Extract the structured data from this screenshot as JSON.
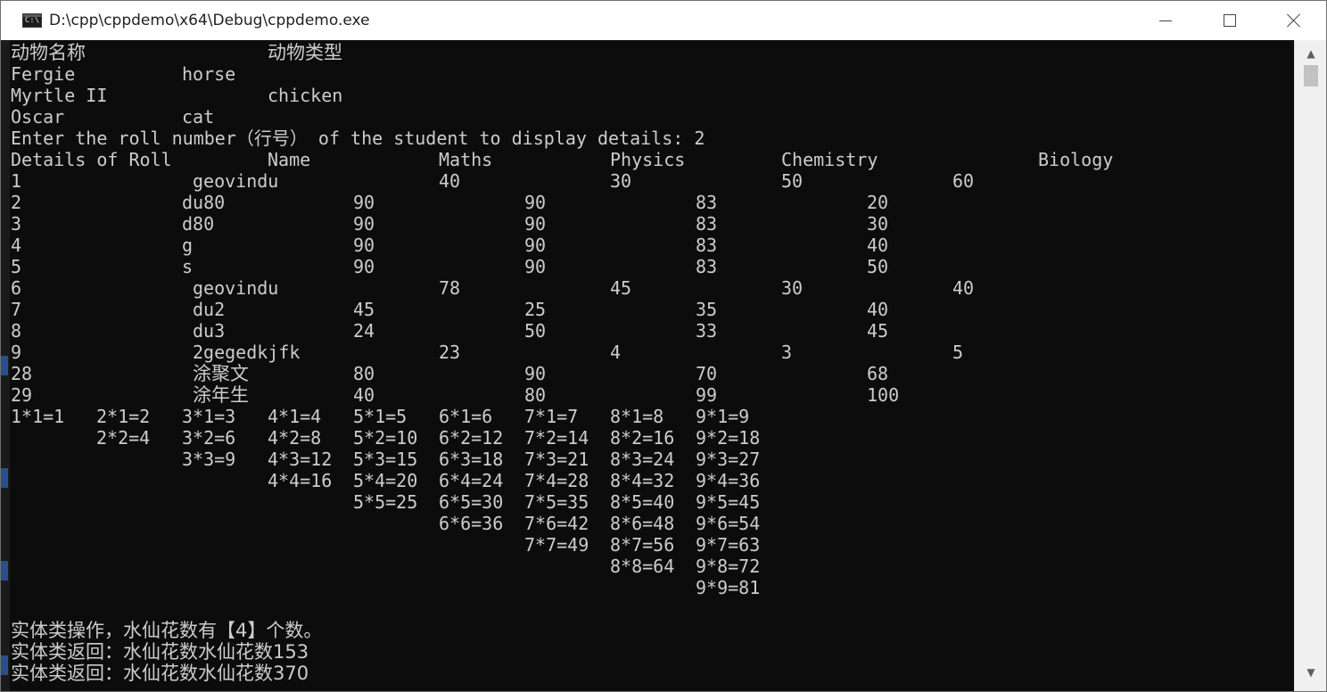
{
  "window": {
    "title": "D:\\cpp\\cppdemo\\x64\\Debug\\cppdemo.exe",
    "icon_label": "C:\\"
  },
  "console_lines": [
    [
      {
        "c": 0,
        "t": "动物名称",
        "cjk": true
      },
      {
        "c": 24,
        "t": "动物类型",
        "cjk": true
      }
    ],
    [
      {
        "c": 0,
        "t": "Fergie"
      },
      {
        "c": 16,
        "t": "horse"
      }
    ],
    [
      {
        "c": 0,
        "t": "Myrtle II"
      },
      {
        "c": 24,
        "t": "chicken"
      }
    ],
    [
      {
        "c": 0,
        "t": "Oscar"
      },
      {
        "c": 16,
        "t": "cat"
      }
    ],
    [
      {
        "c": 0,
        "t": "Enter the roll number（行号） of the student to display details: 2"
      }
    ],
    [
      {
        "c": 0,
        "t": "Details of Roll"
      },
      {
        "c": 24,
        "t": "Name"
      },
      {
        "c": 40,
        "t": "Maths"
      },
      {
        "c": 56,
        "t": "Physics"
      },
      {
        "c": 72,
        "t": "Chemistry"
      },
      {
        "c": 96,
        "t": "Biology"
      }
    ],
    [
      {
        "c": 0,
        "t": "1"
      },
      {
        "c": 17,
        "t": "geovindu"
      },
      {
        "c": 40,
        "t": "40"
      },
      {
        "c": 56,
        "t": "30"
      },
      {
        "c": 72,
        "t": "50"
      },
      {
        "c": 88,
        "t": "60"
      }
    ],
    [
      {
        "c": 0,
        "t": "2"
      },
      {
        "c": 16,
        "t": "du80"
      },
      {
        "c": 32,
        "t": "90"
      },
      {
        "c": 48,
        "t": "90"
      },
      {
        "c": 64,
        "t": "83"
      },
      {
        "c": 80,
        "t": "20"
      }
    ],
    [
      {
        "c": 0,
        "t": "3"
      },
      {
        "c": 16,
        "t": "d80"
      },
      {
        "c": 32,
        "t": "90"
      },
      {
        "c": 48,
        "t": "90"
      },
      {
        "c": 64,
        "t": "83"
      },
      {
        "c": 80,
        "t": "30"
      }
    ],
    [
      {
        "c": 0,
        "t": "4"
      },
      {
        "c": 16,
        "t": "g"
      },
      {
        "c": 32,
        "t": "90"
      },
      {
        "c": 48,
        "t": "90"
      },
      {
        "c": 64,
        "t": "83"
      },
      {
        "c": 80,
        "t": "40"
      }
    ],
    [
      {
        "c": 0,
        "t": "5"
      },
      {
        "c": 16,
        "t": "s"
      },
      {
        "c": 32,
        "t": "90"
      },
      {
        "c": 48,
        "t": "90"
      },
      {
        "c": 64,
        "t": "83"
      },
      {
        "c": 80,
        "t": "50"
      }
    ],
    [
      {
        "c": 0,
        "t": "6"
      },
      {
        "c": 17,
        "t": "geovindu"
      },
      {
        "c": 40,
        "t": "78"
      },
      {
        "c": 56,
        "t": "45"
      },
      {
        "c": 72,
        "t": "30"
      },
      {
        "c": 88,
        "t": "40"
      }
    ],
    [
      {
        "c": 0,
        "t": "7"
      },
      {
        "c": 17,
        "t": "du2"
      },
      {
        "c": 32,
        "t": "45"
      },
      {
        "c": 48,
        "t": "25"
      },
      {
        "c": 64,
        "t": "35"
      },
      {
        "c": 80,
        "t": "40"
      }
    ],
    [
      {
        "c": 0,
        "t": "8"
      },
      {
        "c": 17,
        "t": "du3"
      },
      {
        "c": 32,
        "t": "24"
      },
      {
        "c": 48,
        "t": "50"
      },
      {
        "c": 64,
        "t": "33"
      },
      {
        "c": 80,
        "t": "45"
      }
    ],
    [
      {
        "c": 0,
        "t": "9"
      },
      {
        "c": 17,
        "t": "2gegedkjfk"
      },
      {
        "c": 40,
        "t": "23"
      },
      {
        "c": 56,
        "t": "4"
      },
      {
        "c": 72,
        "t": "3"
      },
      {
        "c": 88,
        "t": "5"
      }
    ],
    [
      {
        "c": 0,
        "t": "28"
      },
      {
        "c": 17,
        "t": "涂聚文",
        "cjk": true
      },
      {
        "c": 32,
        "t": "80"
      },
      {
        "c": 48,
        "t": "90"
      },
      {
        "c": 64,
        "t": "70"
      },
      {
        "c": 80,
        "t": "68"
      }
    ],
    [
      {
        "c": 0,
        "t": "29"
      },
      {
        "c": 17,
        "t": "涂年生",
        "cjk": true
      },
      {
        "c": 32,
        "t": "40"
      },
      {
        "c": 48,
        "t": "80"
      },
      {
        "c": 64,
        "t": "99"
      },
      {
        "c": 80,
        "t": "100"
      }
    ],
    [
      {
        "c": 0,
        "t": "1*1=1"
      },
      {
        "c": 8,
        "t": "2*1=2"
      },
      {
        "c": 16,
        "t": "3*1=3"
      },
      {
        "c": 24,
        "t": "4*1=4"
      },
      {
        "c": 32,
        "t": "5*1=5"
      },
      {
        "c": 40,
        "t": "6*1=6"
      },
      {
        "c": 48,
        "t": "7*1=7"
      },
      {
        "c": 56,
        "t": "8*1=8"
      },
      {
        "c": 64,
        "t": "9*1=9"
      }
    ],
    [
      {
        "c": 8,
        "t": "2*2=4"
      },
      {
        "c": 16,
        "t": "3*2=6"
      },
      {
        "c": 24,
        "t": "4*2=8"
      },
      {
        "c": 32,
        "t": "5*2=10"
      },
      {
        "c": 40,
        "t": "6*2=12"
      },
      {
        "c": 48,
        "t": "7*2=14"
      },
      {
        "c": 56,
        "t": "8*2=16"
      },
      {
        "c": 64,
        "t": "9*2=18"
      }
    ],
    [
      {
        "c": 16,
        "t": "3*3=9"
      },
      {
        "c": 24,
        "t": "4*3=12"
      },
      {
        "c": 32,
        "t": "5*3=15"
      },
      {
        "c": 40,
        "t": "6*3=18"
      },
      {
        "c": 48,
        "t": "7*3=21"
      },
      {
        "c": 56,
        "t": "8*3=24"
      },
      {
        "c": 64,
        "t": "9*3=27"
      }
    ],
    [
      {
        "c": 24,
        "t": "4*4=16"
      },
      {
        "c": 32,
        "t": "5*4=20"
      },
      {
        "c": 40,
        "t": "6*4=24"
      },
      {
        "c": 48,
        "t": "7*4=28"
      },
      {
        "c": 56,
        "t": "8*4=32"
      },
      {
        "c": 64,
        "t": "9*4=36"
      }
    ],
    [
      {
        "c": 32,
        "t": "5*5=25"
      },
      {
        "c": 40,
        "t": "6*5=30"
      },
      {
        "c": 48,
        "t": "7*5=35"
      },
      {
        "c": 56,
        "t": "8*5=40"
      },
      {
        "c": 64,
        "t": "9*5=45"
      }
    ],
    [
      {
        "c": 40,
        "t": "6*6=36"
      },
      {
        "c": 48,
        "t": "7*6=42"
      },
      {
        "c": 56,
        "t": "8*6=48"
      },
      {
        "c": 64,
        "t": "9*6=54"
      }
    ],
    [
      {
        "c": 48,
        "t": "7*7=49"
      },
      {
        "c": 56,
        "t": "8*7=56"
      },
      {
        "c": 64,
        "t": "9*7=63"
      }
    ],
    [
      {
        "c": 56,
        "t": "8*8=64"
      },
      {
        "c": 64,
        "t": "9*8=72"
      }
    ],
    [
      {
        "c": 64,
        "t": "9*9=81"
      }
    ],
    [],
    [
      {
        "c": 0,
        "t": "实体类操作，水仙花数有【4】个数。",
        "cjk": true
      }
    ],
    [
      {
        "c": 0,
        "t": "实体类返回：水仙花数水仙花数153",
        "cjk": true
      }
    ],
    [
      {
        "c": 0,
        "t": "实体类返回：水仙花数水仙花数370",
        "cjk": true
      }
    ]
  ],
  "scrollbar": {
    "up_icon": "▲",
    "down_icon": "▼"
  },
  "colors": {
    "console_bg": "#0c0c0c",
    "console_text": "#cccccc",
    "titlebar_bg": "#ffffff"
  }
}
